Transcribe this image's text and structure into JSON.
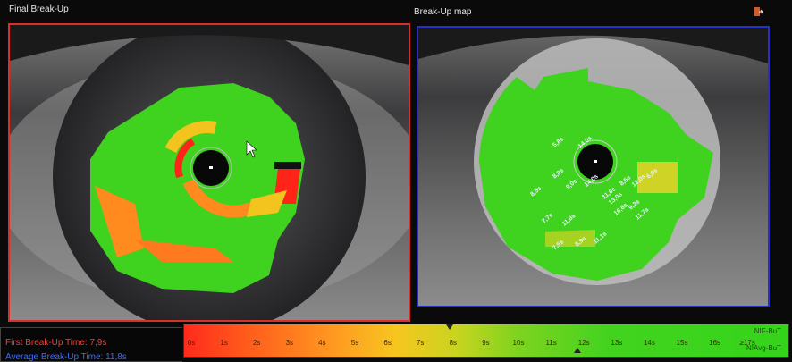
{
  "left_panel": {
    "title": "Final Break-Up",
    "border_color": "#d73028"
  },
  "right_panel": {
    "title": "Break-Up map",
    "border_color": "#2630c8"
  },
  "map_labels": [
    "5,8s",
    "14,0s",
    "8,8s",
    "9,0s",
    "14,0s",
    "8,5s",
    "11,6s",
    "6,6s",
    "12,0s",
    "13,0s",
    "9,2s",
    "16,6s",
    "11,7s",
    "8,5s",
    "7,7s",
    "11,8s",
    "7,5s",
    "8,9s",
    "11,1s"
  ],
  "scale": {
    "ticks": [
      "0s",
      "1s",
      "2s",
      "3s",
      "4s",
      "5s",
      "6s",
      "7s",
      "8s",
      "9s",
      "10s",
      "11s",
      "12s",
      "13s",
      "14s",
      "15s",
      "16s",
      "≥17s"
    ],
    "nif_label": "NIF-BuT",
    "navg_label": "NIAvg-BuT",
    "first_marker_value": 7.9,
    "avg_marker_value": 11.8
  },
  "info": {
    "first_breakup": "First Break-Up Time: 7,9s",
    "average_breakup": "Average Break-Up Time: 11,8s"
  },
  "colors": {
    "green": "#3fd21f",
    "red": "#ff2418",
    "orange": "#ff8a1e",
    "yellow": "#f4c41e"
  },
  "icons": {
    "exit": "exit-icon",
    "cursor": "cursor-icon"
  }
}
